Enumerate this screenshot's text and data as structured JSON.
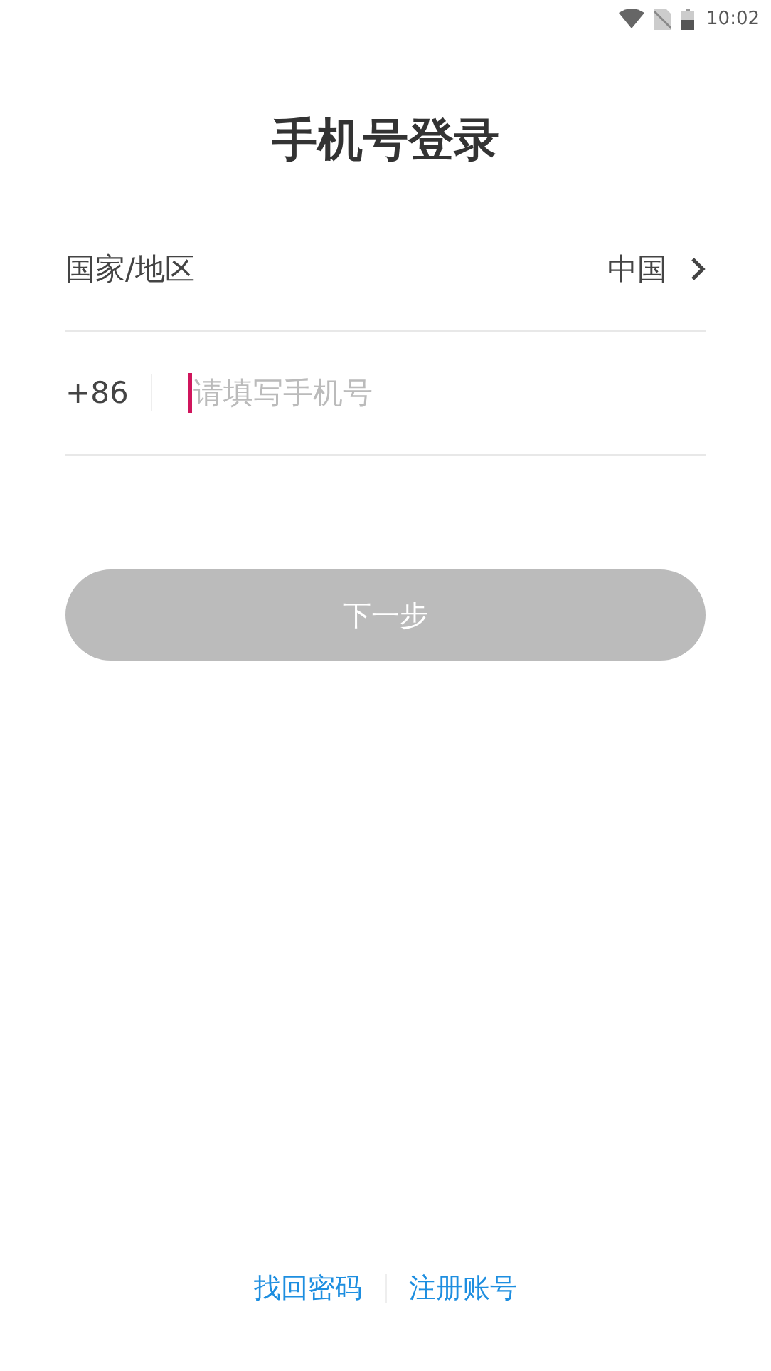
{
  "status_bar": {
    "time": "10:02"
  },
  "title": "手机号登录",
  "region": {
    "label": "国家/地区",
    "value": "中国"
  },
  "phone": {
    "code": "+86",
    "placeholder": "请填写手机号"
  },
  "next_button": {
    "label": "下一步",
    "disabled": true
  },
  "links": [
    "找回密码",
    "注册账号"
  ]
}
